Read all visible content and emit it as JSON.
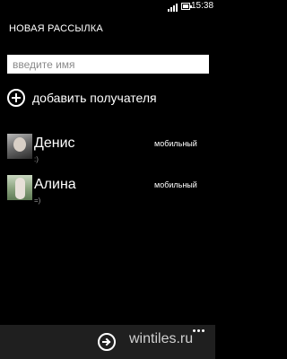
{
  "status_bar": {
    "time": "15:38"
  },
  "header": {
    "title": "НОВАЯ РАССЫЛКА"
  },
  "name_field": {
    "value": "",
    "placeholder": "введите имя"
  },
  "add_recipient": {
    "label": "добавить получателя"
  },
  "contacts": [
    {
      "name": "Денис",
      "status": ":)",
      "type": "мобильный"
    },
    {
      "name": "Алина",
      "status": "=)",
      "type": "мобильный"
    }
  ],
  "app_bar": {
    "watermark": "wintiles.ru"
  },
  "icons": [
    "signal-icon",
    "battery-icon",
    "add-icon",
    "next-arrow-icon",
    "more-dots-icon"
  ],
  "colors": {
    "background": "#000000",
    "text": "#ffffff",
    "input_bg": "#ffffff",
    "app_bar": "#1f1f1f"
  }
}
